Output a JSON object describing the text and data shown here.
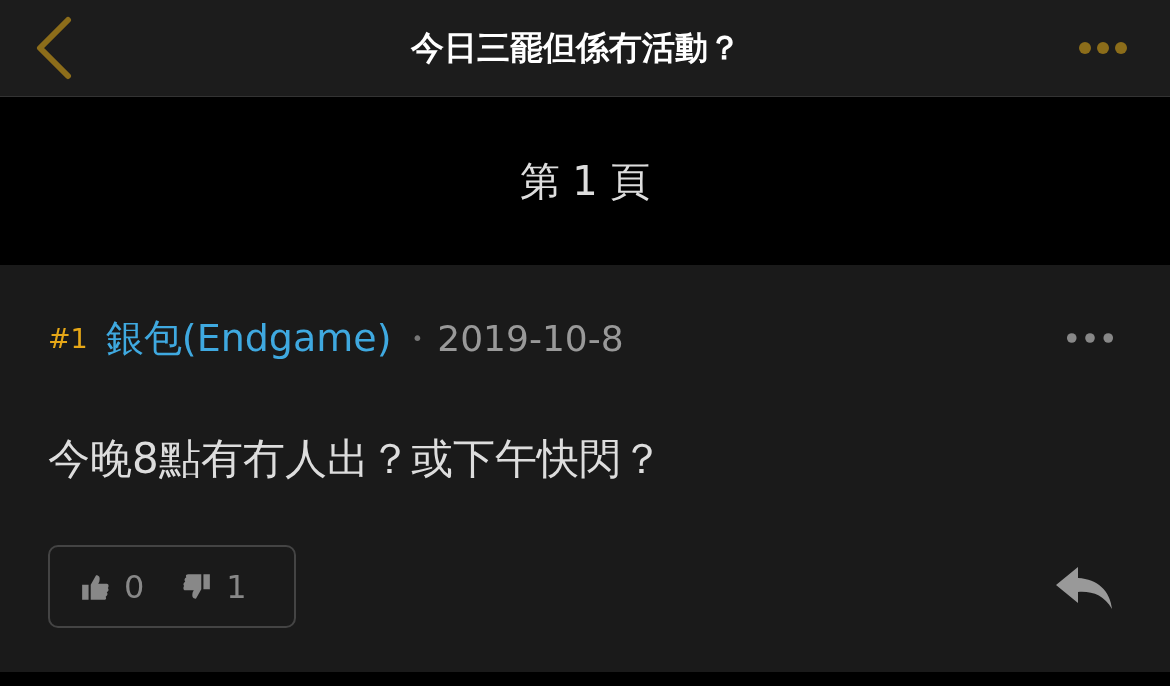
{
  "header": {
    "title": "今日三罷但係冇活動？"
  },
  "page_label": "第 1 頁",
  "posts": [
    {
      "floor": "#1",
      "author": "銀包(Endgame)",
      "separator": "•",
      "date": "2019-10-8",
      "content": "今晚8點有冇人出？或下午快閃？",
      "likes": "0",
      "dislikes": "1"
    }
  ]
}
